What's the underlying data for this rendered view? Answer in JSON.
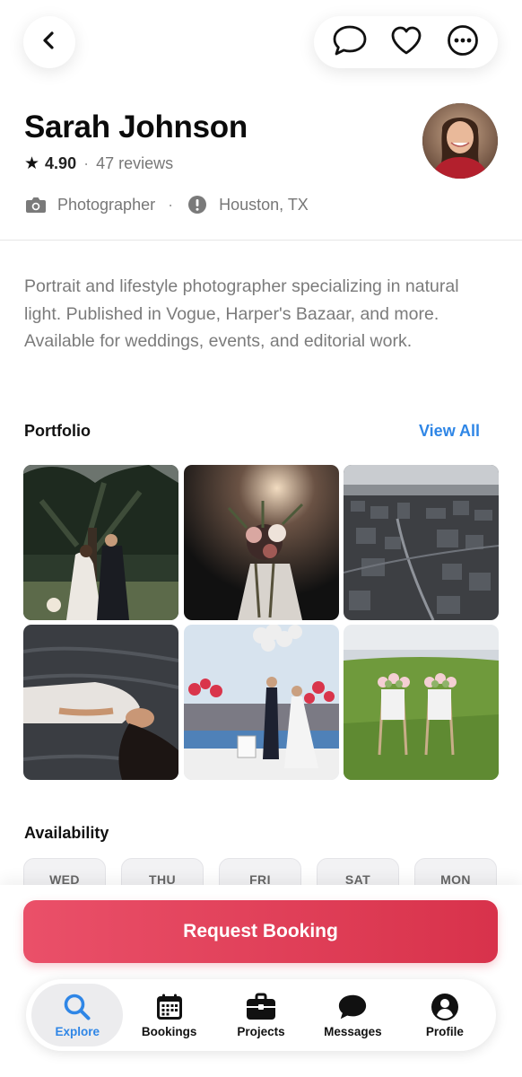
{
  "header": {
    "back_icon": "chevron-left-icon",
    "actions": [
      {
        "icon": "chat-bubble-icon"
      },
      {
        "icon": "heart-icon"
      },
      {
        "icon": "more-icon"
      }
    ]
  },
  "profile": {
    "name": "Sarah Johnson",
    "rating": "4.90",
    "dot": "·",
    "reviews": "47 reviews",
    "profession": "Photographer",
    "location": "Houston, TX",
    "meta_dot": "·"
  },
  "bio": "Portrait and lifestyle photographer specializing in natural light. Published in Vogue, Harper's Bazaar, and more. Available for weddings, events, and editorial work.",
  "portfolio": {
    "title": "Portfolio",
    "view_all": "View All"
  },
  "availability": {
    "title": "Availability",
    "days": [
      "WED",
      "THU",
      "FRI",
      "SAT",
      "MON"
    ]
  },
  "cta": {
    "label": "Request Booking"
  },
  "tabbar": {
    "active": "Explore",
    "tabs": [
      {
        "label": "Explore",
        "icon": "search-icon"
      },
      {
        "label": "Bookings",
        "icon": "calendar-icon"
      },
      {
        "label": "Projects",
        "icon": "briefcase-icon"
      },
      {
        "label": "Messages",
        "icon": "chat-bubble-icon"
      },
      {
        "label": "Profile",
        "icon": "profile-icon"
      }
    ]
  },
  "colors": {
    "accent_blue": "#2f86e6",
    "cta_red": "#e0405a",
    "muted_text": "#7b7b7b"
  }
}
